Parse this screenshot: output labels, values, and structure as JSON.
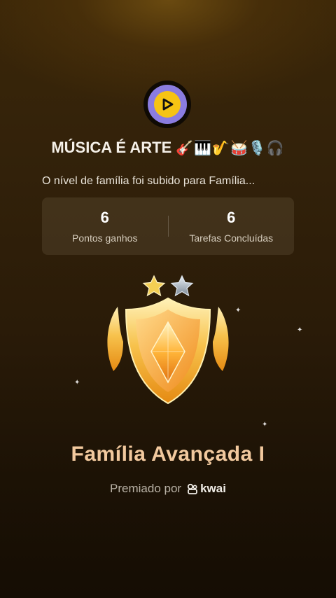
{
  "header": {
    "family_name": "MÚSICA É ARTE",
    "family_emojis": "🎸🎹🎷🥁🎙️🎧",
    "subtitle": "O nível de família foi subido para Família..."
  },
  "stats": [
    {
      "value": "6",
      "label": "Pontos ganhos"
    },
    {
      "value": "6",
      "label": "Tarefas Concluídas"
    }
  ],
  "badge": {
    "stars_earned": 1,
    "stars_total": 2,
    "level_name": "Família Avançada I"
  },
  "footer": {
    "awarded_by_label": "Premiado por",
    "brand_name": "kwai"
  },
  "colors": {
    "accent_gold": "#f6c413",
    "level_text": "#f2c99e"
  }
}
